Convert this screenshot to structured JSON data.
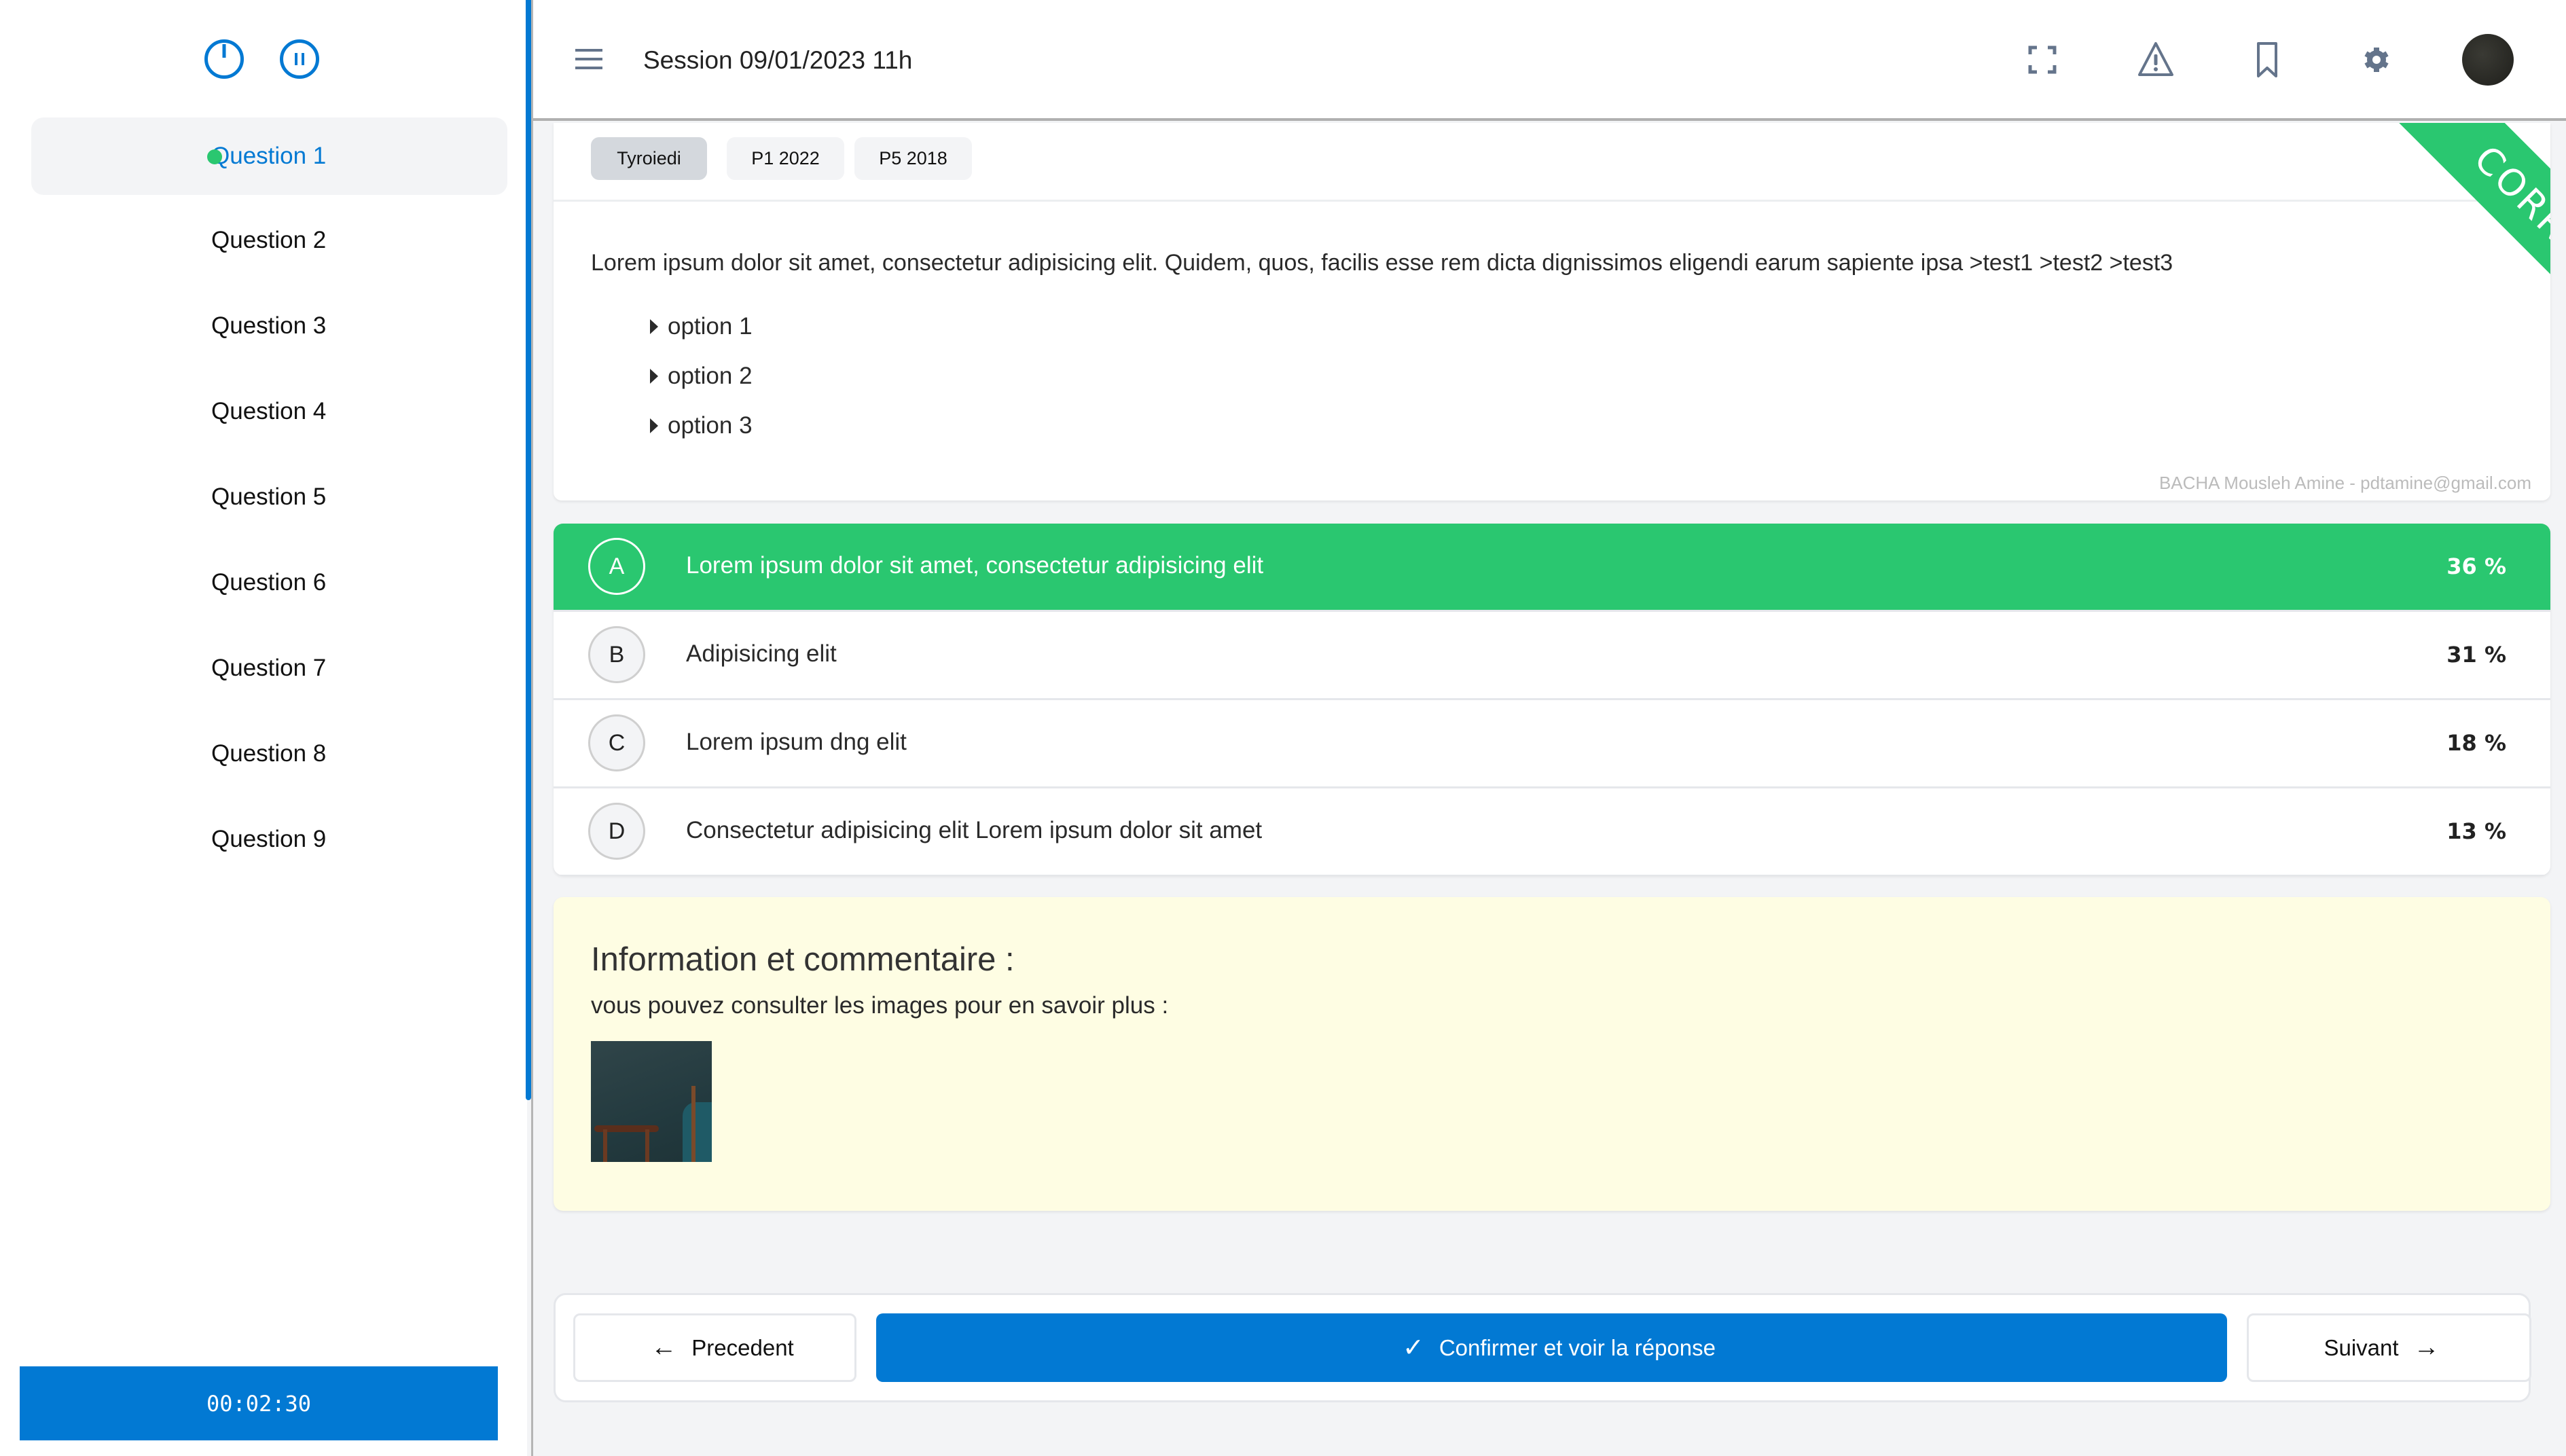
{
  "sidebar": {
    "top_icons": [
      {
        "name": "power-icon",
        "label": "power"
      },
      {
        "name": "pause-icon",
        "label": "pause"
      }
    ],
    "questions": [
      {
        "label": "Question 1",
        "active": true,
        "answered": true
      },
      {
        "label": "Question 2",
        "active": false
      },
      {
        "label": "Question 3",
        "active": false
      },
      {
        "label": "Question 4",
        "active": false
      },
      {
        "label": "Question 5",
        "active": false
      },
      {
        "label": "Question 6",
        "active": false
      },
      {
        "label": "Question 7",
        "active": false
      },
      {
        "label": "Question 8",
        "active": false
      },
      {
        "label": "Question 9",
        "active": false
      }
    ],
    "timer": "00:02:30"
  },
  "header": {
    "menu_icon": "hamburger-icon",
    "title": "Session 09/01/2023 11h",
    "icons": [
      "fullscreen-icon",
      "warning-icon",
      "bookmark-icon",
      "gear-icon"
    ],
    "avatar": "user-avatar"
  },
  "question": {
    "tags": [
      {
        "label": "Tyroiedi",
        "active": true
      },
      {
        "label": "P1 2022",
        "active": false
      },
      {
        "label": "P5 2018",
        "active": false
      }
    ],
    "text": "Lorem ipsum dolor sit amet, consectetur adipisicing elit. Quidem, quos, facilis esse rem dicta dignissimos eligendi earum sapiente ipsa >test1 >test2 >test3",
    "options": [
      "option 1",
      "option 2",
      "option 3"
    ],
    "ribbon": "CORRECT",
    "credit": "BACHA Mousleh Amine - pdtamine@gmail.com"
  },
  "answers": [
    {
      "letter": "A",
      "text": "Lorem ipsum dolor sit amet, consectetur adipisicing elit",
      "percent": "36 %",
      "correct": true
    },
    {
      "letter": "B",
      "text": "Adipisicing elit",
      "percent": "31 %",
      "correct": false
    },
    {
      "letter": "C",
      "text": "Lorem ipsum dng elit",
      "percent": "18 %",
      "correct": false
    },
    {
      "letter": "D",
      "text": "Consectetur adipisicing elit Lorem ipsum dolor sit amet",
      "percent": "13 %",
      "correct": false
    }
  ],
  "info": {
    "title": "Information et commentaire :",
    "subtitle": "vous pouvez consulter les images pour en savoir plus :"
  },
  "nav": {
    "prev_label": "Precedent",
    "confirm_label": "Confirmer et voir la réponse",
    "next_label": "Suivant"
  },
  "colors": {
    "primary": "#0279d3",
    "success": "#2ac770",
    "info_bg": "#fefde3"
  }
}
